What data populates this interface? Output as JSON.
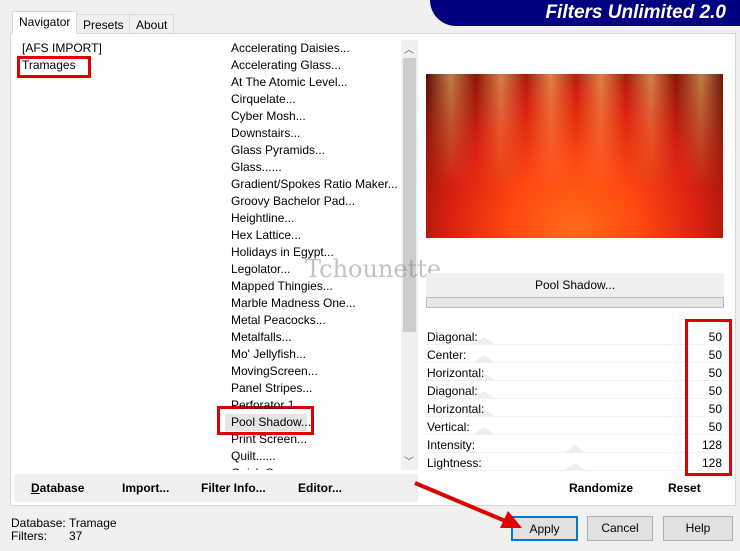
{
  "tabs": [
    {
      "label": "Navigator"
    },
    {
      "label": "Presets"
    },
    {
      "label": "About"
    }
  ],
  "banner": "Filters Unlimited 2.0",
  "categories": [
    "[AFS IMPORT]",
    "Tramages"
  ],
  "filters": [
    "Accelerating Daisies...",
    "Accelerating Glass...",
    "At The Atomic Level...",
    "Cirquelate...",
    "Cyber Mosh...",
    "Downstairs...",
    "Glass Pyramids...",
    "Glass......",
    "Gradient/Spokes Ratio Maker...",
    "Groovy Bachelor Pad...",
    "Heightline...",
    "Hex Lattice...",
    "Holidays in Egypt...",
    "Legolator...",
    "Mapped Thingies...",
    "Marble Madness One...",
    "Metal Peacocks...",
    "Metalfalls...",
    "Mo' Jellyfish...",
    "MovingScreen...",
    "Panel Stripes...",
    "Perforator 1",
    "Pool Shadow...",
    "Print Screen...",
    "Quilt......",
    "Quick Cu..."
  ],
  "selected_filter": "Pool Shadow...",
  "watermark": "Tchounette",
  "filter_name": "Pool Shadow...",
  "sliders": [
    {
      "label": "Diagonal:",
      "value": 50
    },
    {
      "label": "Center:",
      "value": 50
    },
    {
      "label": "Horizontal:",
      "value": 50
    },
    {
      "label": "Diagonal:",
      "value": 50
    },
    {
      "label": "Horizontal:",
      "value": 50
    },
    {
      "label": "Vertical:",
      "value": 50
    },
    {
      "label": "Intensity:",
      "value": 128
    },
    {
      "label": "Lightness:",
      "value": 128
    }
  ],
  "slider_max": 255,
  "toolbar": {
    "database": "Database",
    "import": "Import...",
    "filter_info": "Filter Info...",
    "editor": "Editor...",
    "randomize": "Randomize",
    "reset": "Reset"
  },
  "status": {
    "database_label": "Database:",
    "database_value": "Tramage",
    "filters_label": "Filters:",
    "filters_value": "37"
  },
  "buttons": {
    "apply": "Apply",
    "cancel": "Cancel",
    "help": "Help"
  },
  "colors": {
    "banner": "#000080",
    "highlight": "#e00000",
    "accent": "#0078d7"
  }
}
